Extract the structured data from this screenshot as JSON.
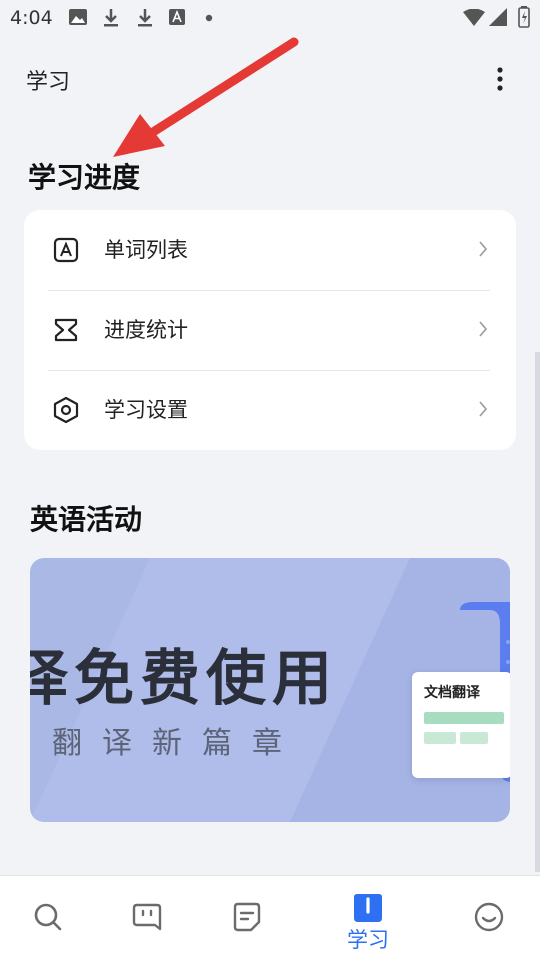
{
  "status_bar": {
    "time": "4:04"
  },
  "app_bar": {
    "title": "学习"
  },
  "progress_section": {
    "title": "学习进度",
    "items": [
      {
        "label": "单词列表",
        "icon": "word-list-icon"
      },
      {
        "label": "进度统计",
        "icon": "progress-stats-icon"
      },
      {
        "label": "学习设置",
        "icon": "settings-hexagon-icon"
      }
    ]
  },
  "activity_section": {
    "title": "英语活动",
    "banner": {
      "headline": "译免费使用",
      "subline": "翻译新篇章",
      "doc_label": "文档翻译"
    }
  },
  "bottom_nav": {
    "active_label": "学习",
    "active_color": "#2f6ff3",
    "tabs": [
      "search-icon",
      "chat-face-icon",
      "notes-icon",
      "study-book-icon",
      "smile-icon"
    ]
  },
  "annotation_arrow_color": "#e53935"
}
